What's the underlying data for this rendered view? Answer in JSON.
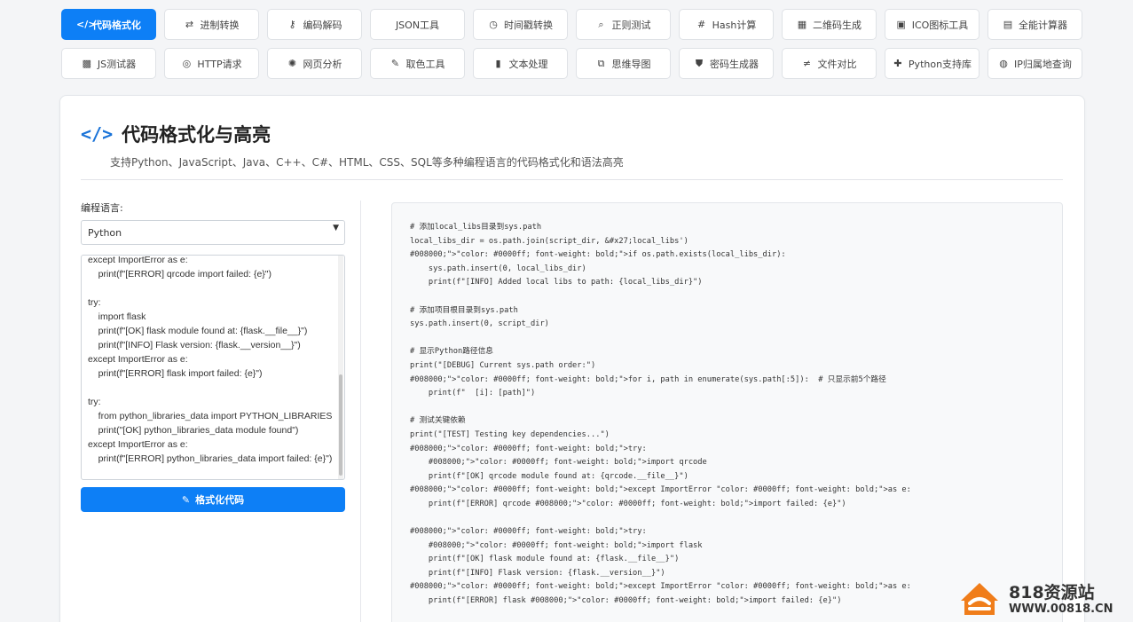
{
  "nav": {
    "items": [
      {
        "icon": "</>",
        "label": "代码格式化",
        "active": true
      },
      {
        "icon": "⇄",
        "label": "进制转换"
      },
      {
        "icon": "⚷",
        "label": "编码解码"
      },
      {
        "icon": "",
        "label": "JSON工具"
      },
      {
        "icon": "◷",
        "label": "时间戳转换"
      },
      {
        "icon": "⌕",
        "label": "正则测试"
      },
      {
        "icon": "#",
        "label": "Hash计算"
      },
      {
        "icon": "▦",
        "label": "二维码生成"
      },
      {
        "icon": "▣",
        "label": "ICO图标工具"
      },
      {
        "icon": "▤",
        "label": "全能计算器"
      },
      {
        "icon": "▩",
        "label": "JS测试器"
      },
      {
        "icon": "◎",
        "label": "HTTP请求"
      },
      {
        "icon": "✺",
        "label": "网页分析"
      },
      {
        "icon": "✎",
        "label": "取色工具"
      },
      {
        "icon": "▮",
        "label": "文本处理"
      },
      {
        "icon": "⧉",
        "label": "思维导图"
      },
      {
        "icon": "⛊",
        "label": "密码生成器"
      },
      {
        "icon": "≠",
        "label": "文件对比"
      },
      {
        "icon": "✚",
        "label": "Python支持库"
      },
      {
        "icon": "◍",
        "label": "IP归属地查询"
      }
    ]
  },
  "header": {
    "icon": "</>",
    "title": "代码格式化与高亮",
    "subtitle": "支持Python、JavaScript、Java、C++、C#、HTML、CSS、SQL等多种编程语言的代码格式化和语法高亮"
  },
  "form": {
    "language_label": "编程语言:",
    "language_value": "Python",
    "input_code": "except ImportError as e:\n    print(f\"[ERROR] qrcode import failed: {e}\")\n\ntry:\n    import flask\n    print(f\"[OK] flask module found at: {flask.__file__}\")\n    print(f\"[INFO] Flask version: {flask.__version__}\")\nexcept ImportError as e:\n    print(f\"[ERROR] flask import failed: {e}\")\n\ntry:\n    from python_libraries_data import PYTHON_LIBRARIES\n    print(\"[OK] python_libraries_data module found\")\nexcept ImportError as e:\n    print(f\"[ERROR] python_libraries_data import failed: {e}\")",
    "format_button": "格式化代码"
  },
  "output": {
    "code": "# 添加local_libs目录到sys.path\nlocal_libs_dir = os.path.join(script_dir, &#x27;local_libs')\n#008000;\">\"color: #0000ff; font-weight: bold;\">if os.path.exists(local_libs_dir):\n    sys.path.insert(0, local_libs_dir)\n    print(f\"[INFO] Added local libs to path: {local_libs_dir}\")\n\n# 添加项目根目录到sys.path\nsys.path.insert(0, script_dir)\n\n# 显示Python路径信息\nprint(\"[DEBUG] Current sys.path order:\")\n#008000;\">\"color: #0000ff; font-weight: bold;\">for i, path in enumerate(sys.path[:5]):  # 只显示前5个路径\n    print(f\"  [i]: [path]\")\n\n# 测试关键依赖\nprint(\"[TEST] Testing key dependencies...\")\n#008000;\">\"color: #0000ff; font-weight: bold;\">try:\n    #008000;\">\"color: #0000ff; font-weight: bold;\">import qrcode\n    print(f\"[OK] qrcode module found at: {qrcode.__file__}\")\n#008000;\">\"color: #0000ff; font-weight: bold;\">except ImportError \"color: #0000ff; font-weight: bold;\">as e:\n    print(f\"[ERROR] qrcode #008000;\">\"color: #0000ff; font-weight: bold;\">import failed: {e}\")\n\n#008000;\">\"color: #0000ff; font-weight: bold;\">try:\n    #008000;\">\"color: #0000ff; font-weight: bold;\">import flask\n    print(f\"[OK] flask module found at: {flask.__file__}\")\n    print(f\"[INFO] Flask version: {flask.__version__}\")\n#008000;\">\"color: #0000ff; font-weight: bold;\">except ImportError \"color: #0000ff; font-weight: bold;\">as e:\n    print(f\"[ERROR] flask #008000;\">\"color: #0000ff; font-weight: bold;\">import failed: {e}\")"
  },
  "watermark": {
    "name": "818资源站",
    "url": "WWW.00818.CN"
  },
  "colors": {
    "accent": "#0d7ff6",
    "logo_orange": "#f07d1a"
  }
}
